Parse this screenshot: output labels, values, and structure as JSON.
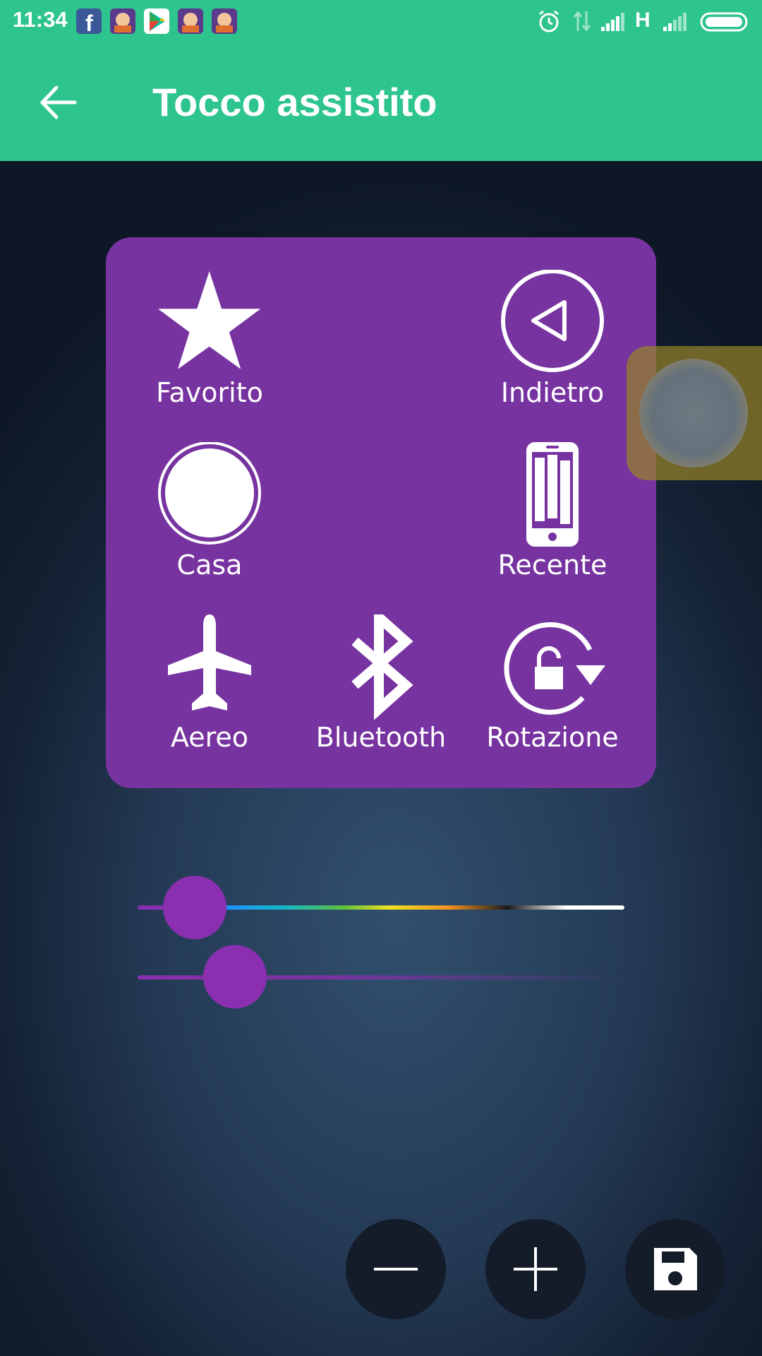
{
  "status_bar": {
    "time": "11:34",
    "notification_icons": [
      "facebook-icon",
      "game-icon",
      "play-store-icon",
      "game-icon",
      "game-icon"
    ],
    "system_icons": [
      "alarm-icon",
      "data-arrows-icon",
      "signal-icon",
      "network-type-icon",
      "signal-icon",
      "battery-icon"
    ],
    "network_type": "H"
  },
  "app_bar": {
    "title": "Tocco assistito",
    "back_icon": "back-arrow-icon"
  },
  "menu_panel": {
    "items": [
      {
        "label": "Favorito",
        "icon": "star-icon"
      },
      {
        "label": "Indietro",
        "icon": "back-triangle-icon"
      },
      {
        "label": "Casa",
        "icon": "home-circle-icon"
      },
      {
        "label": "Recente",
        "icon": "recent-apps-icon"
      },
      {
        "label": "Aereo",
        "icon": "airplane-icon"
      },
      {
        "label": "Bluetooth",
        "icon": "bluetooth-icon"
      },
      {
        "label": "Rotazione",
        "icon": "rotation-lock-icon"
      }
    ]
  },
  "sliders": [
    {
      "name": "color",
      "value_fraction": 0.12
    },
    {
      "name": "opacity",
      "value_fraction": 0.2
    }
  ],
  "actions": [
    {
      "name": "zoom-out",
      "icon": "minus-icon"
    },
    {
      "name": "zoom-in",
      "icon": "plus-icon"
    },
    {
      "name": "save",
      "icon": "save-icon"
    }
  ],
  "colors": {
    "accent": "#2ec48e",
    "panel": "#7733a0",
    "slider_thumb": "#8a2fb0"
  }
}
